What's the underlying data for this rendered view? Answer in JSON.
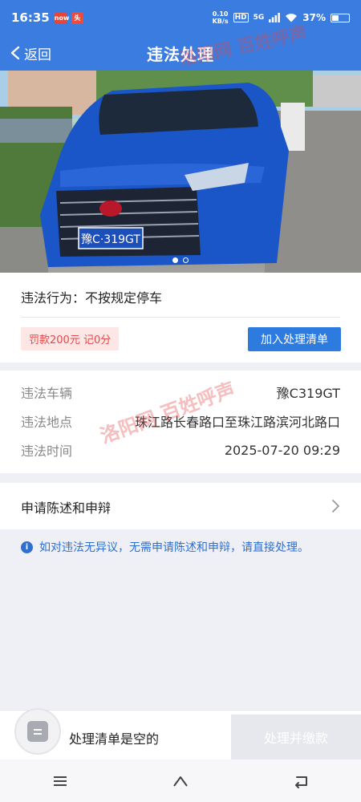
{
  "status_bar": {
    "time": "16:35",
    "badge1": "now",
    "badge2": "头",
    "net_speed_value": "0.10",
    "net_speed_unit": "KB/s",
    "hd": "HD",
    "signal": "5G",
    "battery": "37%"
  },
  "header": {
    "back_label": "返回",
    "title": "违法处理"
  },
  "photo": {
    "plate_text": "豫C·319GT",
    "slide_count": 2,
    "active_slide": 1
  },
  "violation": {
    "behavior_label": "违法行为：",
    "behavior_value": "不按规定停车",
    "fine_text": "罚款200元 记0分",
    "add_button": "加入处理清单"
  },
  "details": {
    "rows": [
      {
        "label": "违法车辆",
        "value": "豫C319GT"
      },
      {
        "label": "违法地点",
        "value": "珠江路长春路口至珠江路滨河北路口"
      },
      {
        "label": "违法时间",
        "value": "2025-07-20 09:29"
      }
    ]
  },
  "appeal": {
    "label": "申请陈述和申辩"
  },
  "notice": {
    "icon": "i",
    "text": "如对违法无异议，无需申请陈述和申辩，请直接处理。"
  },
  "cart": {
    "empty_text": "处理清单是空的",
    "pay_button": "处理并缴款"
  },
  "watermarks": {
    "header_mark": "洛阳网 百姓呼声",
    "detail_mark": "洛阳网 百姓呼声",
    "bottom_mark": "洛阳网 百姓呼声"
  },
  "colors": {
    "primary": "#3a7ce0",
    "fine_bg": "#fde6e6",
    "fine_text": "#e34a4a",
    "notice": "#2e6fcf"
  }
}
